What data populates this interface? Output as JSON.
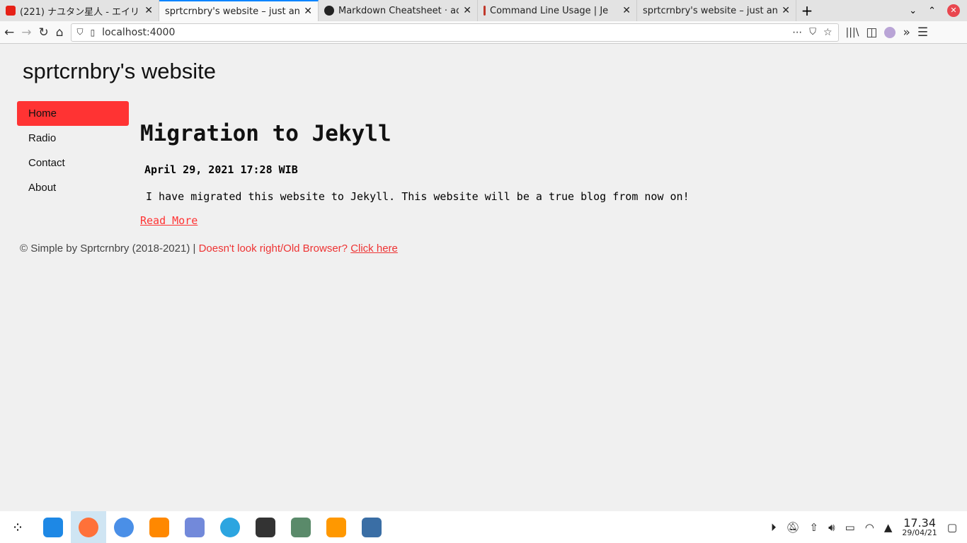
{
  "browser": {
    "tabs": [
      {
        "title": "(221) ナユタン星人 - エイリ",
        "icon": "youtube-icon",
        "color": "#e62117"
      },
      {
        "title": "sprtcrnbry's website – just and",
        "icon": "page-icon",
        "color": "#aaaaaa",
        "active": true
      },
      {
        "title": "Markdown Cheatsheet · ad",
        "icon": "github-icon",
        "color": "#222222"
      },
      {
        "title": "Command Line Usage | Je",
        "icon": "jekyll-icon",
        "color": "#c0392b"
      },
      {
        "title": "sprtcrnbry's website – just and",
        "icon": "page-icon",
        "color": "#aaaaaa"
      }
    ],
    "new_tab": "+",
    "url": "localhost:4000"
  },
  "site": {
    "title": "sprtcrnbry's website",
    "nav": [
      "Home",
      "Radio",
      "Contact",
      "About"
    ],
    "post": {
      "title": "Migration to Jekyll",
      "date": "April 29, 2021 17:28 WIB",
      "body": "I have migrated this website to Jekyll. This website will be a true blog from now on!",
      "read_more": "Read More"
    },
    "footer": {
      "copyright": "© Simple by Sprtcrnbry (2018-2021) | ",
      "notice": "Doesn't look right/Old Browser? ",
      "link": "Click here"
    },
    "accent": "#ff3333"
  },
  "taskbar": {
    "apps": [
      {
        "name": "files",
        "color": "#1e88e5"
      },
      {
        "name": "firefox",
        "color": "#ff7139",
        "active": true
      },
      {
        "name": "chromium",
        "color": "#4a8fe7"
      },
      {
        "name": "vlc",
        "color": "#ff8800"
      },
      {
        "name": "discord",
        "color": "#7289da"
      },
      {
        "name": "telegram",
        "color": "#2ca5e0"
      },
      {
        "name": "terminal",
        "color": "#333333"
      },
      {
        "name": "network-manager",
        "color": "#5a8a6a"
      },
      {
        "name": "sublime-text",
        "color": "#ff9800"
      },
      {
        "name": "wine-app",
        "color": "#3a6ea5"
      }
    ],
    "time": "17.34",
    "date": "29/04/21"
  }
}
